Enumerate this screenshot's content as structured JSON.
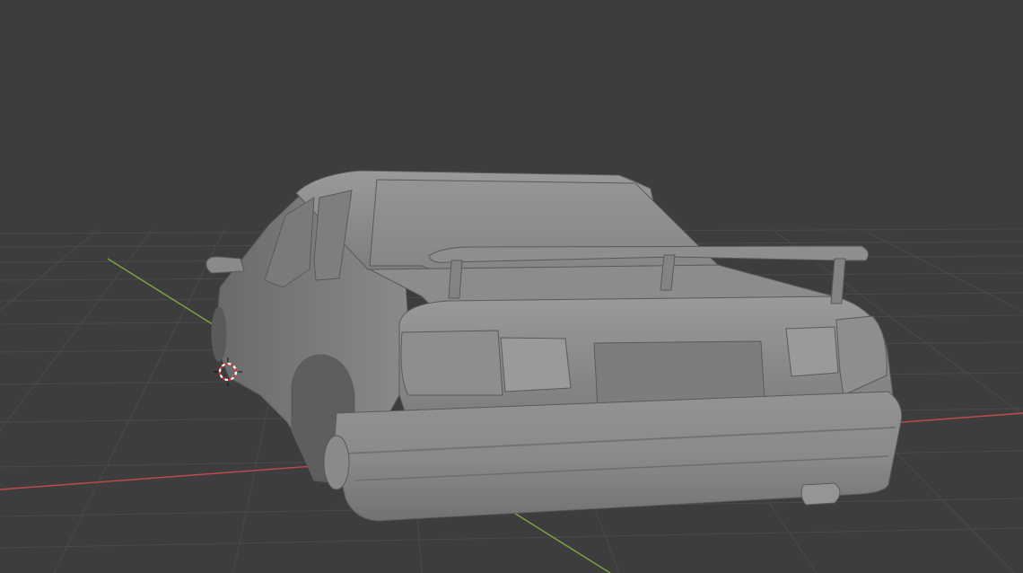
{
  "app": {
    "viewport": {
      "mode": "solid-shading",
      "background": "#3d3d3d",
      "grid": {
        "visible": true,
        "line_color": "#4a4a4a",
        "x_axis_color": "#c24a4e",
        "y_axis_color": "#7aa342"
      },
      "object": {
        "type": "mesh",
        "description_icon": "car-mesh",
        "base_color": "#8f8f8f"
      },
      "cursor_3d": {
        "icon": "3d-cursor-icon",
        "ring_colors": [
          "#e03030",
          "#ffffff"
        ]
      }
    }
  }
}
